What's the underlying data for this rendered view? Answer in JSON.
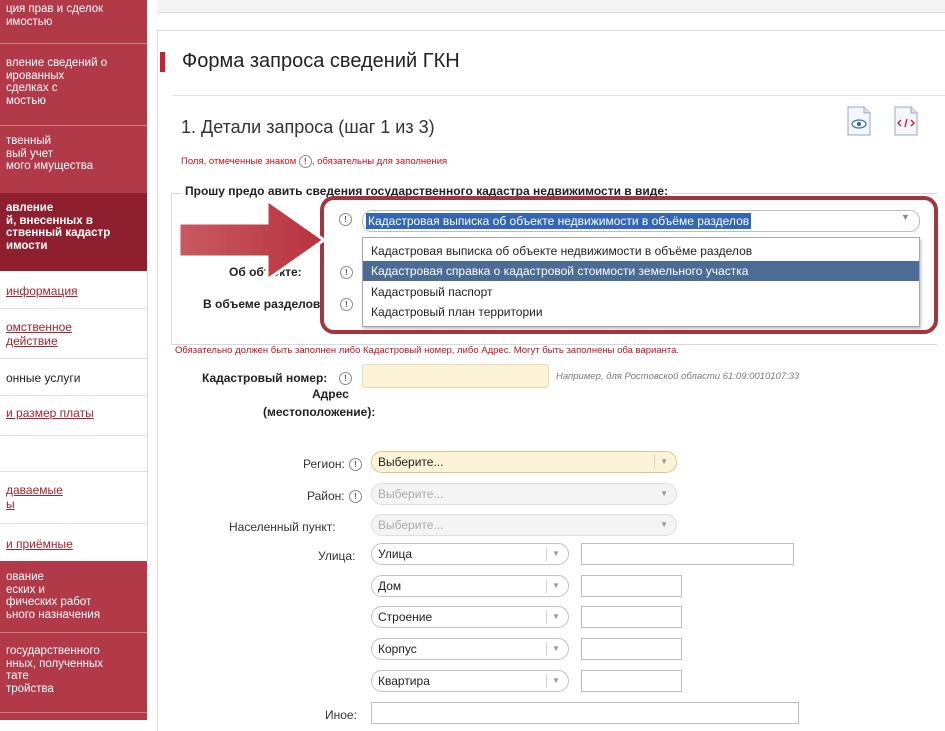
{
  "sidebar": {
    "items": [
      {
        "label": "ция прав и сделок\nимостью"
      },
      {
        "label": "вление сведений о\nированных\nсделках с\nмостью"
      },
      {
        "label": "твенный\nвый учет\nмого имущества"
      },
      {
        "label": "авление\nй, внесенных в\nственный кадастр\nимости"
      },
      {
        "label": "ование\nеских и\nфических работ\nьного назначения"
      },
      {
        "label": "государственного\nнных, полученных\nтате\nтройства"
      }
    ],
    "submenu": [
      {
        "label": "информация"
      },
      {
        "label": "омственное\nдействие"
      },
      {
        "label": "онные услуги"
      },
      {
        "label": "и размер платы"
      },
      {
        "label": "даваемые\nы"
      },
      {
        "label": "и приёмные"
      }
    ]
  },
  "page": {
    "title": "Форма запроса сведений ГКН",
    "step_title": "1. Детали запроса (шаг 1 из 3)",
    "required_note_before": "Поля, отмеченные знаком ",
    "required_note_after": ", обязательны для заполнения",
    "required_mark": "!",
    "legend": "Прошу предо     авить сведения государственного кадастра недвижимости в виде:",
    "view_select": {
      "value": "Кадастровая выписка об объекте недвижимости в объёме разделов",
      "options": [
        "Кадастровая выписка об объекте недвижимости в объёме разделов",
        "Кадастровая справка о кадастровой стоимости земельного участка",
        "Кадастровый паспорт",
        "Кадастровый план территории"
      ],
      "highlighted_index": 1
    },
    "object_label": "Об    объекте:",
    "sections_label": "В объеме разделов:",
    "or_note": "Обязательно должен быть заполнен либо Кадастровый номер, либо Адрес. Могут быть заполнены оба варианта.",
    "cadastral_label": "Кадастровый номер:",
    "cadastral_hint": "Например, для Ростовской области 61:09:0010107:33",
    "address_label_1": "Адрес",
    "address_label_2": "(местоположение):",
    "region_label": "Регион:",
    "region_value": "Выберите...",
    "district_label": "Район:",
    "district_value": "Выберите...",
    "settlement_label": "Населенный пункт:",
    "settlement_value": "Выберите...",
    "street_label": "Улица:",
    "street_type": "Улица",
    "house_type": "Дом",
    "building_type": "Строение",
    "block_type": "Корпус",
    "apt_type": "Квартира",
    "other_label": "Иное:",
    "colors": {
      "accent": "#b23a48",
      "callout": "#a6343f",
      "required": "#c8101e"
    }
  }
}
